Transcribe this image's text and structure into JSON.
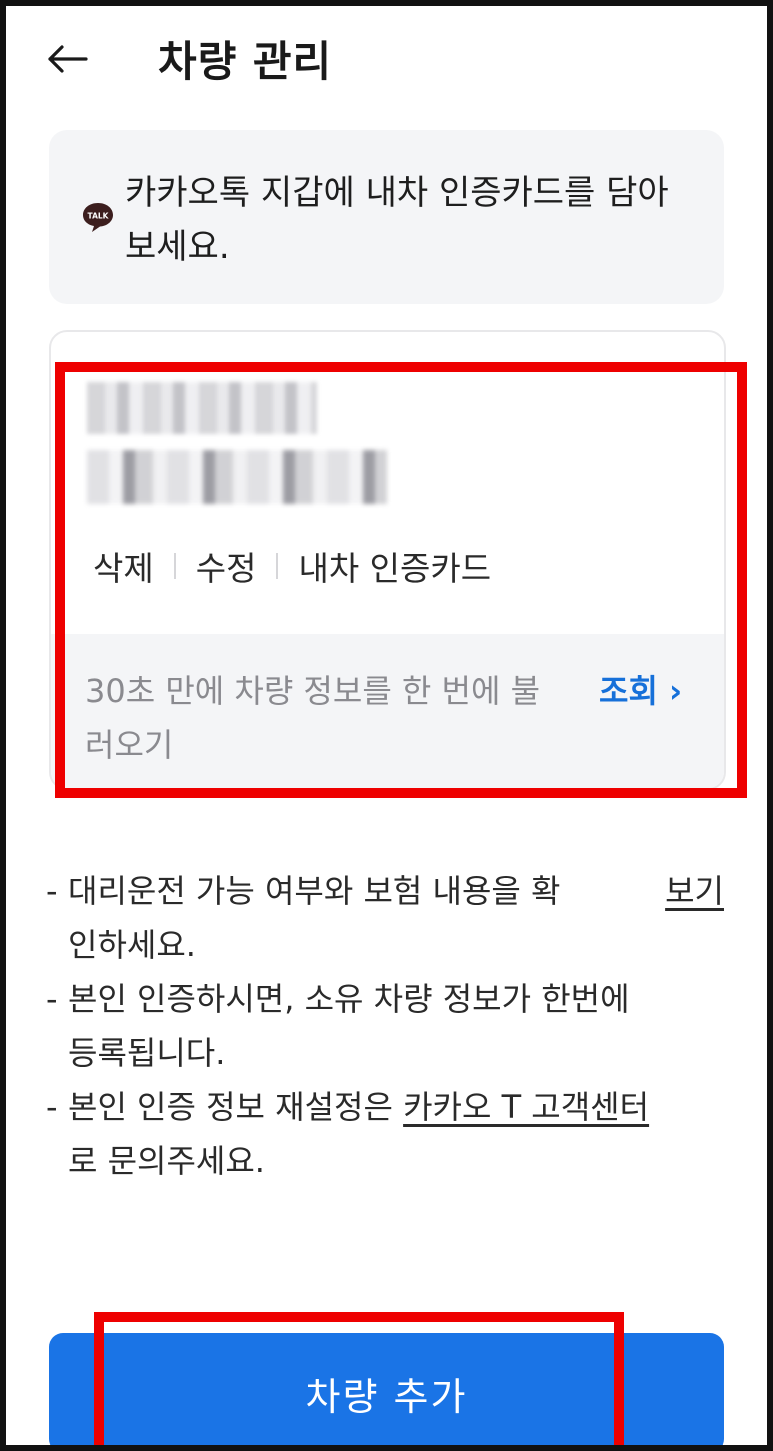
{
  "header": {
    "title": "차량 관리"
  },
  "banner": {
    "icon_label": "TALK",
    "text": "카카오톡 지갑에 내차 인증카드를 담아보세요."
  },
  "vehicle_card": {
    "actions": {
      "delete": "삭제",
      "edit": "수정",
      "my_car_card": "내차 인증카드"
    },
    "lookup": {
      "text": "30초 만에 차량 정보를 한 번에 불러오기",
      "button": "조회 ›"
    }
  },
  "notes": {
    "note1_line1": "대리운전 가능 여부와 보험 내용을 확",
    "note1_line2": "인하세요.",
    "note1_link": "보기",
    "note2_line1": "본인 인증하시면, 소유 차량 정보가 한번에",
    "note2_line2": "등록됩니다.",
    "note3_prefix": "본인 인증 정보 재설정은 ",
    "note3_link": "카카오 T 고객센터",
    "note3_line2": "로 문의주세요."
  },
  "add_button": {
    "label": "차량 추가"
  },
  "colors": {
    "accent": "#1a74e6",
    "link_blue": "#1670d9",
    "highlight": "#ee0000",
    "talk_icon": "#3c1e1e"
  }
}
